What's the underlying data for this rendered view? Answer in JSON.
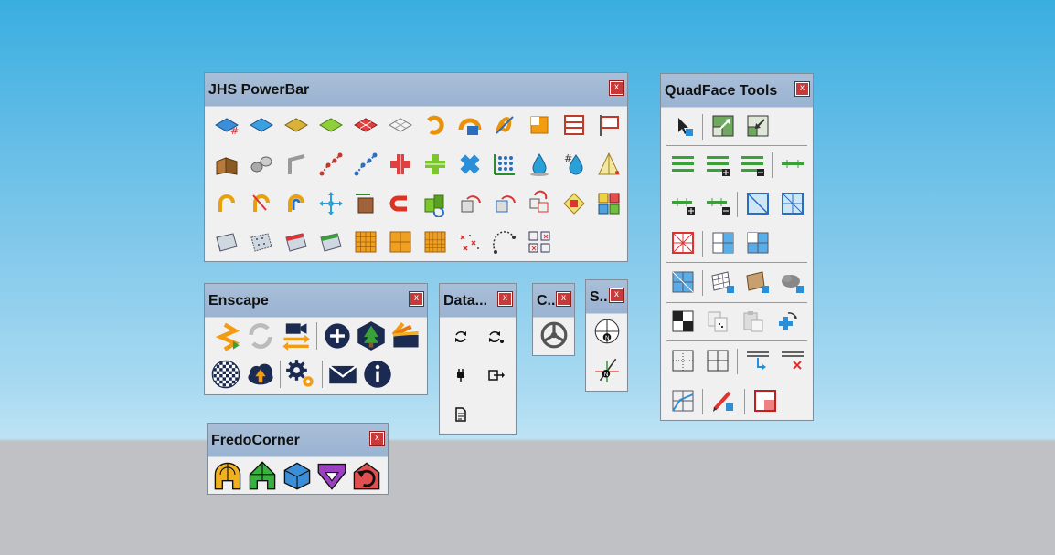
{
  "panels": {
    "jhs": {
      "title": "JHS PowerBar",
      "close": "x"
    },
    "quadface": {
      "title": "QuadFace Tools",
      "close": "x"
    },
    "enscape": {
      "title": "Enscape",
      "close": "x"
    },
    "datasmith": {
      "title": "Data...",
      "close": "x"
    },
    "c": {
      "title": "C..",
      "close": "x"
    },
    "s": {
      "title": "S..",
      "close": "x"
    },
    "fredo": {
      "title": "FredoCorner",
      "close": "x"
    }
  },
  "colors": {
    "sky_top": "#3aaee0",
    "sky_bottom": "#bde3f4",
    "ground": "#c0c1c4",
    "titlebar": "#9ab3d1",
    "close": "#c83a3a"
  }
}
